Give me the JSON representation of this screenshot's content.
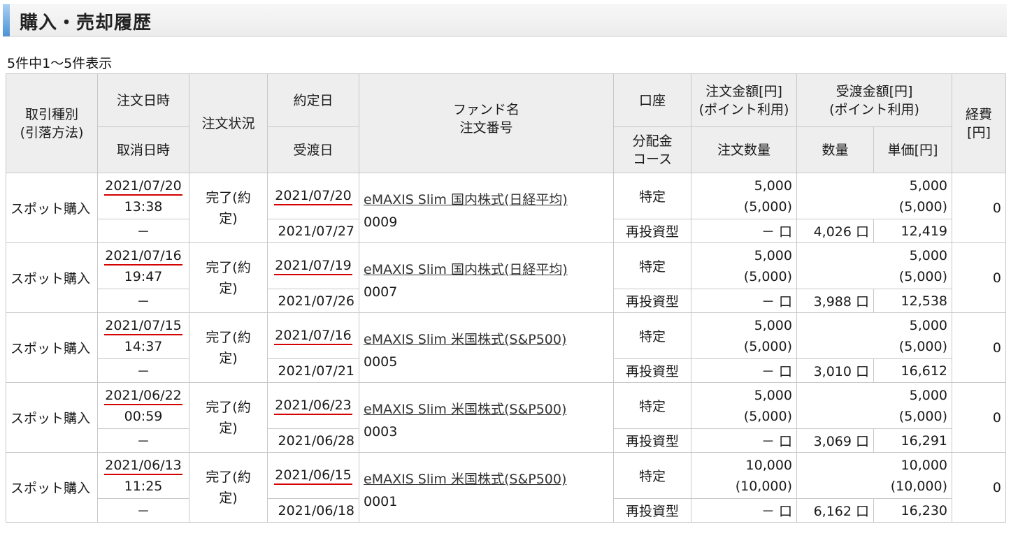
{
  "title": "購入・売却履歴",
  "count_text": "5件中1～5件表示",
  "headers": {
    "type": "取引種別\n(引落方法)",
    "order_dt": "注文日時",
    "cancel_dt": "取消日時",
    "status": "注文状況",
    "contract": "約定日",
    "delivery": "受渡日",
    "fund": "ファンド名\n注文番号",
    "account": "口座",
    "dist": "分配金\nコース",
    "order_amt": "注文金額[円]\n(ポイント利用)",
    "order_qty": "注文数量",
    "deliv_amt": "受渡金額[円]\n(ポイント利用)",
    "qty": "数量",
    "unit_price": "単価[円]",
    "fee": "経費\n[円]"
  },
  "rows": [
    {
      "type": "スポット購入",
      "order_date": "2021/07/20",
      "order_time": "13:38",
      "cancel": "－",
      "status": "完了(約定)",
      "contract_date": "2021/07/20",
      "delivery_date": "2021/07/27",
      "fund": "eMAXIS Slim 国内株式(日経平均)",
      "order_no": "0009",
      "account": "特定",
      "dist": "再投資型",
      "order_amt": "5,000",
      "order_pt": "(5,000)",
      "order_qty": "－ 口",
      "deliv_amt": "5,000",
      "deliv_pt": "(5,000)",
      "qty": "4,026 口",
      "unit_price": "12,419",
      "fee": "0"
    },
    {
      "type": "スポット購入",
      "order_date": "2021/07/16",
      "order_time": "19:47",
      "cancel": "－",
      "status": "完了(約定)",
      "contract_date": "2021/07/19",
      "delivery_date": "2021/07/26",
      "fund": "eMAXIS Slim 国内株式(日経平均)",
      "order_no": "0007",
      "account": "特定",
      "dist": "再投資型",
      "order_amt": "5,000",
      "order_pt": "(5,000)",
      "order_qty": "－ 口",
      "deliv_amt": "5,000",
      "deliv_pt": "(5,000)",
      "qty": "3,988 口",
      "unit_price": "12,538",
      "fee": "0"
    },
    {
      "type": "スポット購入",
      "order_date": "2021/07/15",
      "order_time": "14:37",
      "cancel": "－",
      "status": "完了(約定)",
      "contract_date": "2021/07/16",
      "delivery_date": "2021/07/21",
      "fund": "eMAXIS Slim 米国株式(S&P500)",
      "order_no": "0005",
      "account": "特定",
      "dist": "再投資型",
      "order_amt": "5,000",
      "order_pt": "(5,000)",
      "order_qty": "－ 口",
      "deliv_amt": "5,000",
      "deliv_pt": "(5,000)",
      "qty": "3,010 口",
      "unit_price": "16,612",
      "fee": "0"
    },
    {
      "type": "スポット購入",
      "order_date": "2021/06/22",
      "order_time": "00:59",
      "cancel": "－",
      "status": "完了(約定)",
      "contract_date": "2021/06/23",
      "delivery_date": "2021/06/28",
      "fund": "eMAXIS Slim 米国株式(S&P500)",
      "order_no": "0003",
      "account": "特定",
      "dist": "再投資型",
      "order_amt": "5,000",
      "order_pt": "(5,000)",
      "order_qty": "－ 口",
      "deliv_amt": "5,000",
      "deliv_pt": "(5,000)",
      "qty": "3,069 口",
      "unit_price": "16,291",
      "fee": "0"
    },
    {
      "type": "スポット購入",
      "order_date": "2021/06/13",
      "order_time": "11:25",
      "cancel": "－",
      "status": "完了(約定)",
      "contract_date": "2021/06/15",
      "delivery_date": "2021/06/18",
      "fund": "eMAXIS Slim 米国株式(S&P500)",
      "order_no": "0001",
      "account": "特定",
      "dist": "再投資型",
      "order_amt": "10,000",
      "order_pt": "(10,000)",
      "order_qty": "－ 口",
      "deliv_amt": "10,000",
      "deliv_pt": "(10,000)",
      "qty": "6,162 口",
      "unit_price": "16,230",
      "fee": "0"
    }
  ],
  "colors": {
    "underline": "#d40000",
    "header_bg": "#eeeeee",
    "title_accent": "#4c93d6"
  }
}
